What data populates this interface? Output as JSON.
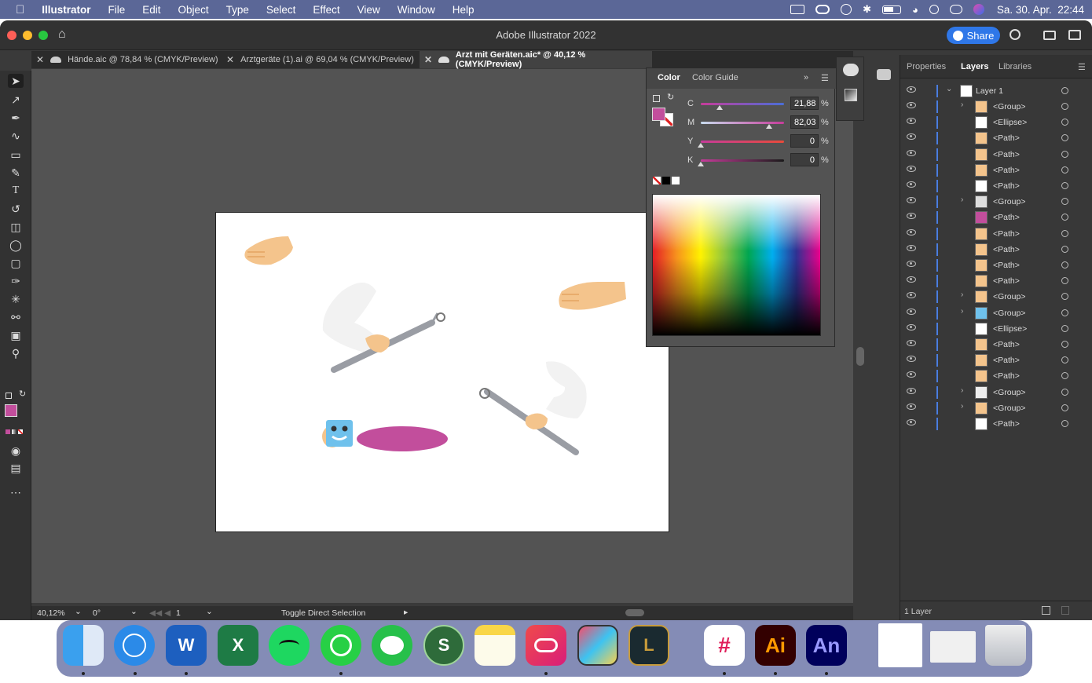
{
  "menubar": {
    "apple": "",
    "app": "Illustrator",
    "items": [
      "File",
      "Edit",
      "Object",
      "Type",
      "Select",
      "Effect",
      "View",
      "Window",
      "Help"
    ],
    "datetime": "Sa. 30. Apr.  22:44"
  },
  "window": {
    "title": "Adobe Illustrator 2022",
    "share_label": "Share"
  },
  "tabs": [
    {
      "label": "Hände.aic @ 78,84 % (CMYK/Preview)"
    },
    {
      "label": "Arztgeräte (1).ai @ 69,04 % (CMYK/Preview)"
    },
    {
      "label": "Arzt mit Geräten.aic* @ 40,12 % (CMYK/Preview)"
    }
  ],
  "color_panel": {
    "tab_color": "Color",
    "tab_guide": "Color Guide",
    "sliders": [
      {
        "label": "C",
        "value": "21,88",
        "unit": "%",
        "level": 0.2188
      },
      {
        "label": "M",
        "value": "82,03",
        "unit": "%",
        "level": 0.8203
      },
      {
        "label": "Y",
        "value": "0",
        "unit": "%",
        "level": 0
      },
      {
        "label": "K",
        "value": "0",
        "unit": "%",
        "level": 0
      }
    ],
    "fill_color": "#c24e9c"
  },
  "right_panel": {
    "tabs": [
      "Properties",
      "Layers",
      "Libraries"
    ],
    "active_tab": "Layers",
    "layer_name": "Layer 1",
    "items": [
      {
        "name": "<Group>",
        "expandable": true
      },
      {
        "name": "<Ellipse>",
        "expandable": false
      },
      {
        "name": "<Path>",
        "expandable": false
      },
      {
        "name": "<Path>",
        "expandable": false
      },
      {
        "name": "<Path>",
        "expandable": false
      },
      {
        "name": "<Path>",
        "expandable": false
      },
      {
        "name": "<Group>",
        "expandable": true
      },
      {
        "name": "<Path>",
        "expandable": false
      },
      {
        "name": "<Path>",
        "expandable": false
      },
      {
        "name": "<Path>",
        "expandable": false
      },
      {
        "name": "<Path>",
        "expandable": false
      },
      {
        "name": "<Path>",
        "expandable": false
      },
      {
        "name": "<Group>",
        "expandable": true
      },
      {
        "name": "<Group>",
        "expandable": true
      },
      {
        "name": "<Ellipse>",
        "expandable": false
      },
      {
        "name": "<Path>",
        "expandable": false
      },
      {
        "name": "<Path>",
        "expandable": false
      },
      {
        "name": "<Path>",
        "expandable": false
      },
      {
        "name": "<Group>",
        "expandable": true
      },
      {
        "name": "<Group>",
        "expandable": true
      },
      {
        "name": "<Path>",
        "expandable": false
      }
    ],
    "footer": "1 Layer"
  },
  "statusbar": {
    "zoom": "40,12%",
    "rotation": "0°",
    "artboard": "1",
    "tool_hint": "Toggle Direct Selection"
  },
  "dock": {
    "apps": [
      "Finder",
      "Safari",
      "Word",
      "Excel",
      "Spotify",
      "WhatsApp",
      "Messages",
      "Scrivener",
      "Notes",
      "Creative Cloud",
      "Final Cut Pro",
      "League of Legends",
      "Slack",
      "Illustrator",
      "Animate",
      "Preview",
      "Screenshot",
      "Trash"
    ],
    "word_letter": "W",
    "excel_letter": "X",
    "ai_letters": "Ai",
    "an_letters": "An"
  },
  "colors": {
    "accent": "#2f77e8",
    "menubar": "#5b6797",
    "magenta_fill": "#c24e9c",
    "skin": "#f4c48c"
  }
}
